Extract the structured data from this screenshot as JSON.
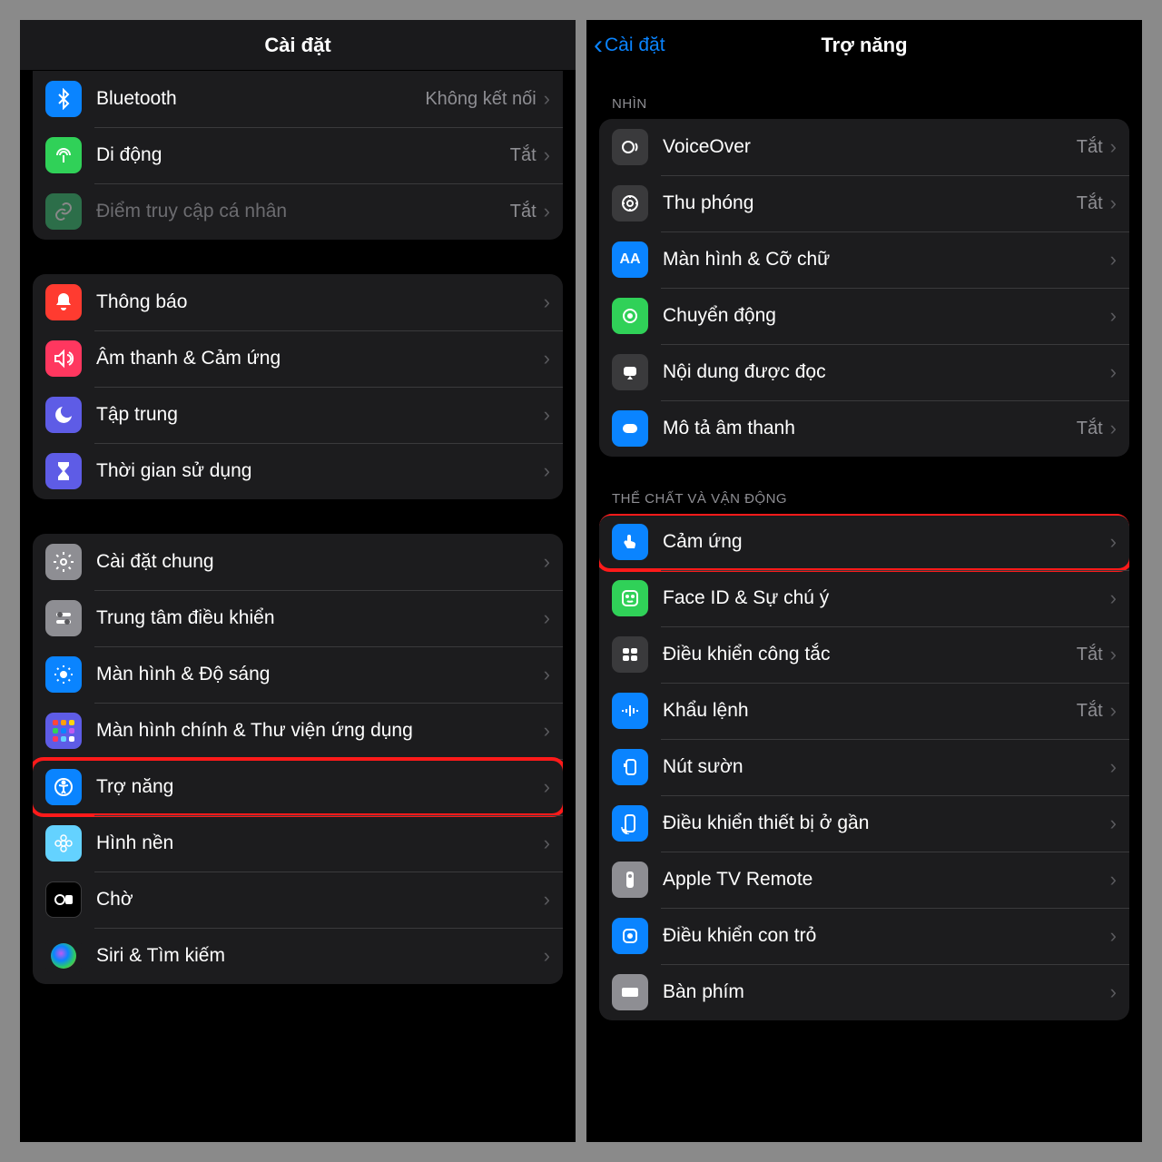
{
  "left": {
    "title": "Cài đặt",
    "groups": [
      {
        "rows": [
          {
            "id": "bluetooth",
            "label": "Bluetooth",
            "status": "Không kết nối",
            "iconBg": "bg-blue"
          },
          {
            "id": "cellular",
            "label": "Di động",
            "status": "Tắt",
            "iconBg": "bg-green"
          },
          {
            "id": "hotspot",
            "label": "Điểm truy cập cá nhân",
            "status": "Tắt",
            "iconBg": "bg-dgreen",
            "dim": true
          }
        ]
      },
      {
        "rows": [
          {
            "id": "notifications",
            "label": "Thông báo",
            "iconBg": "bg-red"
          },
          {
            "id": "sounds",
            "label": "Âm thanh & Cảm ứng",
            "iconBg": "bg-pink"
          },
          {
            "id": "focus",
            "label": "Tập trung",
            "iconBg": "bg-indigo"
          },
          {
            "id": "screentime",
            "label": "Thời gian sử dụng",
            "iconBg": "bg-indigo"
          }
        ]
      },
      {
        "rows": [
          {
            "id": "general",
            "label": "Cài đặt chung",
            "iconBg": "bg-gray"
          },
          {
            "id": "controlcenter",
            "label": "Trung tâm điều khiển",
            "iconBg": "bg-gray"
          },
          {
            "id": "display",
            "label": "Màn hình & Độ sáng",
            "iconBg": "bg-blue"
          },
          {
            "id": "homescreen",
            "label": "Màn hình chính & Thư viện ứng dụng",
            "iconBg": "bg-indigo"
          },
          {
            "id": "accessibility",
            "label": "Trợ năng",
            "iconBg": "bg-blue",
            "highlight": true
          },
          {
            "id": "wallpaper",
            "label": "Hình nền",
            "iconBg": "bg-cyan"
          },
          {
            "id": "standby",
            "label": "Chờ",
            "iconBg": "bg-black"
          },
          {
            "id": "siri",
            "label": "Siri & Tìm kiếm",
            "iconBg": "bg-siri"
          }
        ]
      }
    ]
  },
  "right": {
    "backLabel": "Cài đặt",
    "title": "Trợ năng",
    "sections": [
      {
        "header": "NHÌN",
        "rows": [
          {
            "id": "voiceover",
            "label": "VoiceOver",
            "status": "Tắt",
            "iconBg": "bg-dark"
          },
          {
            "id": "zoom",
            "label": "Thu phóng",
            "status": "Tắt",
            "iconBg": "bg-dark"
          },
          {
            "id": "textsize",
            "label": "Màn hình & Cỡ chữ",
            "iconBg": "bg-blue"
          },
          {
            "id": "motion",
            "label": "Chuyển động",
            "iconBg": "bg-green"
          },
          {
            "id": "spoken",
            "label": "Nội dung được đọc",
            "iconBg": "bg-dark"
          },
          {
            "id": "audiodesc",
            "label": "Mô tả âm thanh",
            "status": "Tắt",
            "iconBg": "bg-blue"
          }
        ]
      },
      {
        "header": "THỂ CHẤT VÀ VẬN ĐỘNG",
        "rows": [
          {
            "id": "touch",
            "label": "Cảm ứng",
            "iconBg": "bg-blue",
            "highlight": true
          },
          {
            "id": "faceid",
            "label": "Face ID & Sự chú ý",
            "iconBg": "bg-green"
          },
          {
            "id": "switchcontrol",
            "label": "Điều khiển công tắc",
            "status": "Tắt",
            "iconBg": "bg-dark"
          },
          {
            "id": "voicecontrol",
            "label": "Khẩu lệnh",
            "status": "Tắt",
            "iconBg": "bg-blue"
          },
          {
            "id": "sidebutton",
            "label": "Nút sườn",
            "iconBg": "bg-blue"
          },
          {
            "id": "nearby",
            "label": "Điều khiển thiết bị ở gần",
            "iconBg": "bg-blue"
          },
          {
            "id": "appletv",
            "label": "Apple TV Remote",
            "iconBg": "bg-gray"
          },
          {
            "id": "pointer",
            "label": "Điều khiển con trỏ",
            "iconBg": "bg-blue"
          },
          {
            "id": "keyboard",
            "label": "Bàn phím",
            "iconBg": "bg-gray"
          }
        ]
      }
    ]
  }
}
